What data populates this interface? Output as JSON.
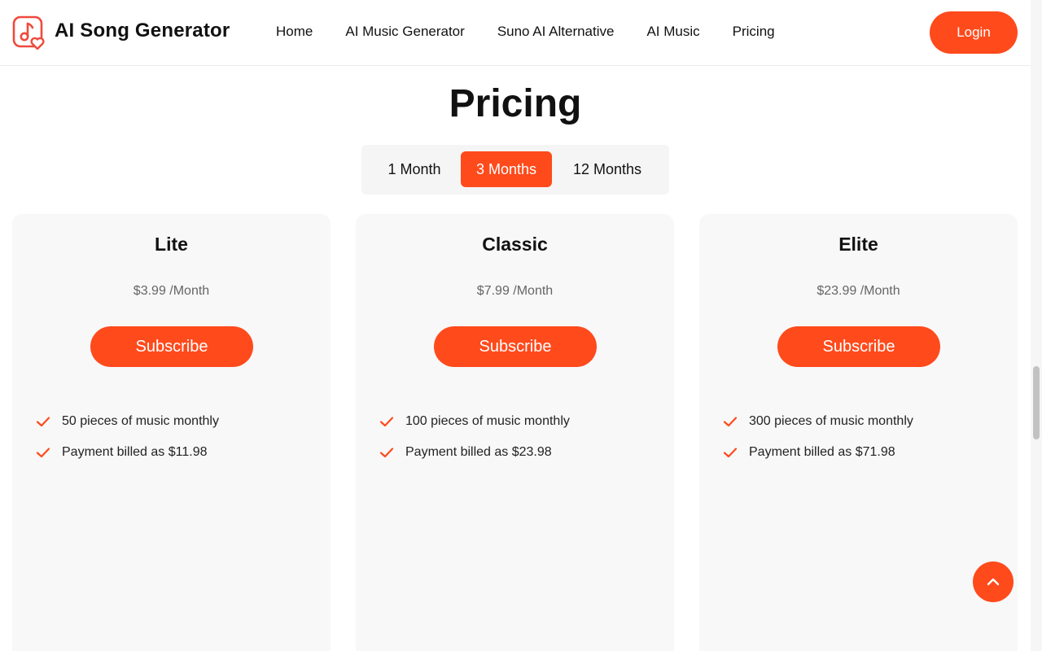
{
  "header": {
    "brand": "AI Song Generator",
    "nav": [
      "Home",
      "AI Music Generator",
      "Suno AI Alternative",
      "AI Music",
      "Pricing"
    ],
    "login_label": "Login"
  },
  "pricing": {
    "title": "Pricing",
    "periods": [
      "1 Month",
      "3 Months",
      "12 Months"
    ],
    "selected_period": "3 Months",
    "plans": [
      {
        "name": "Lite",
        "price": "$3.99 /Month",
        "subscribe_label": "Subscribe",
        "features": [
          "50 pieces of music monthly",
          "Payment billed as $11.98"
        ]
      },
      {
        "name": "Classic",
        "price": "$7.99 /Month",
        "subscribe_label": "Subscribe",
        "features": [
          "100 pieces of music monthly",
          "Payment billed as $23.98"
        ]
      },
      {
        "name": "Elite",
        "price": "$23.99 /Month",
        "subscribe_label": "Subscribe",
        "features": [
          "300 pieces of music monthly",
          "Payment billed as $71.98"
        ]
      }
    ]
  },
  "icons": {
    "logo": "music-note-heart-icon",
    "feature_check": "check-icon",
    "back_to_top": "chevron-up-icon"
  },
  "colors": {
    "accent": "#ff4a1c",
    "card_background": "#f8f8f8",
    "toggle_background": "#f5f5f5"
  }
}
